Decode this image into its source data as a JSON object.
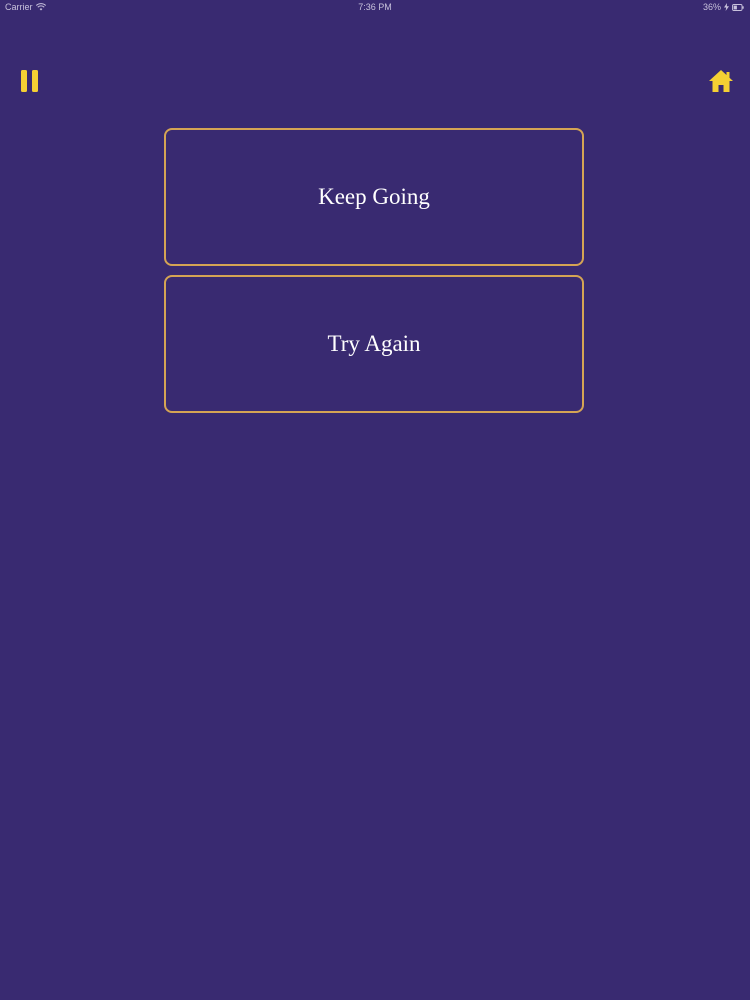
{
  "status_bar": {
    "carrier": "Carrier",
    "time": "7:36 PM",
    "battery": "36%"
  },
  "toolbar": {
    "pause_icon": "pause-icon",
    "home_icon": "home-icon",
    "icon_color": "#F5D033"
  },
  "menu": {
    "keep_going_label": "Keep Going",
    "try_again_label": "Try Again",
    "border_color": "#D5A454"
  },
  "theme": {
    "background": "#392A71",
    "text_color": "#FFFFFF"
  }
}
